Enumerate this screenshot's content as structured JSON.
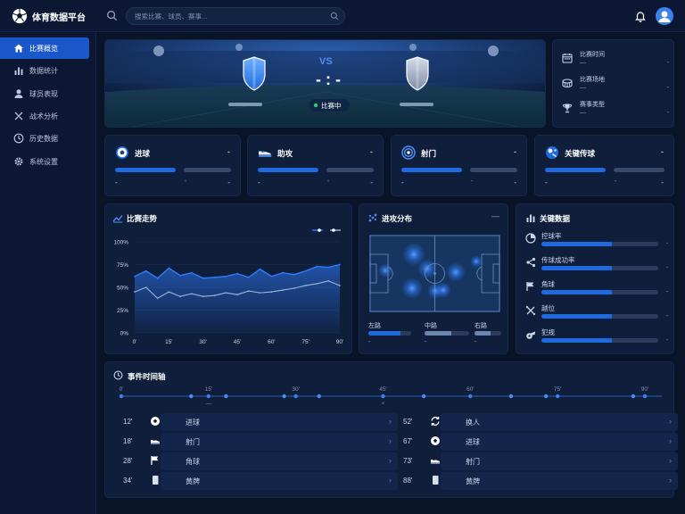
{
  "app": {
    "title": "体育数据平台"
  },
  "search": {
    "placeholder": "搜索比赛、球员、赛事..."
  },
  "sidebar": {
    "items": [
      {
        "label": "比赛概览",
        "icon": "home-icon"
      },
      {
        "label": "数据统计",
        "icon": "bar-chart-icon"
      },
      {
        "label": "球员表现",
        "icon": "user-icon"
      },
      {
        "label": "战术分析",
        "icon": "tactics-icon"
      },
      {
        "label": "历史数据",
        "icon": "clock-icon"
      },
      {
        "label": "系统设置",
        "icon": "gear-icon"
      }
    ]
  },
  "match": {
    "vs": "VS",
    "score": "- : -",
    "status": "比赛中"
  },
  "match_info": [
    {
      "label": "比赛时间",
      "value": "—",
      "value2": "-",
      "icon": "calendar-icon"
    },
    {
      "label": "比赛场地",
      "value": "—",
      "value2": "-",
      "icon": "stadium-icon"
    },
    {
      "label": "赛事类型",
      "value": "—",
      "value2": "-",
      "icon": "trophy-icon"
    }
  ],
  "stats": [
    {
      "label": "进球",
      "top": "-",
      "left": "-",
      "mid": "-",
      "right": "-",
      "icon": "soccer-ball-icon"
    },
    {
      "label": "助攻",
      "top": "-",
      "left": "-",
      "mid": "-",
      "right": "-",
      "icon": "shoe-icon"
    },
    {
      "label": "射门",
      "top": "-",
      "left": "-",
      "mid": "-",
      "right": "-",
      "icon": "target-icon"
    },
    {
      "label": "关键传球",
      "top": "-",
      "left": "-",
      "mid": "-",
      "right": "-",
      "icon": "pass-icon"
    }
  ],
  "trend": {
    "title": "比赛走势"
  },
  "attack": {
    "title": "进攻分布",
    "menu": "—",
    "zones": [
      {
        "label": "左路",
        "value": "-",
        "fill": 0.75
      },
      {
        "label": "中路",
        "value": "-",
        "fill": 0.6
      },
      {
        "label": "右路",
        "value": "-",
        "fill": 0.6
      }
    ]
  },
  "key": {
    "title": "关键数据",
    "rows": [
      {
        "label": "控球率",
        "value": "-",
        "icon": "pie-icon",
        "fill": 0.6
      },
      {
        "label": "传球成功率",
        "value": "-",
        "icon": "share-icon",
        "fill": 0.6
      },
      {
        "label": "角球",
        "value": "-",
        "icon": "flag-icon",
        "fill": 0.6
      },
      {
        "label": "越位",
        "value": "-",
        "icon": "offside-icon",
        "fill": 0.6
      },
      {
        "label": "犯规",
        "value": "-",
        "icon": "whistle-icon",
        "fill": 0.6
      }
    ]
  },
  "events": {
    "title": "事件时间轴",
    "ticks": [
      "0'",
      "15'",
      "30'",
      "45'",
      "60'",
      "75'",
      "90'"
    ],
    "marker_labels": [
      "—",
      "×"
    ],
    "markers": [
      0,
      15,
      30,
      45,
      60,
      75,
      90
    ],
    "left": [
      {
        "time": "12'",
        "label": "进球",
        "icon": "soccer-ball-icon"
      },
      {
        "time": "18'",
        "label": "射门",
        "icon": "shoe-icon"
      },
      {
        "time": "28'",
        "label": "角球",
        "icon": "flag-icon"
      },
      {
        "time": "34'",
        "label": "黄牌",
        "icon": "card-icon"
      }
    ],
    "right": [
      {
        "time": "52'",
        "label": "换人",
        "icon": "substitution-icon"
      },
      {
        "time": "67'",
        "label": "进球",
        "icon": "soccer-ball-icon"
      },
      {
        "time": "73'",
        "label": "射门",
        "icon": "shoe-icon"
      },
      {
        "time": "88'",
        "label": "黄牌",
        "icon": "card-icon"
      }
    ]
  },
  "chart_data": {
    "type": "area",
    "title": "",
    "xlabel": "",
    "ylabel": "",
    "x": [
      0,
      5,
      10,
      15,
      20,
      25,
      30,
      35,
      40,
      45,
      50,
      55,
      60,
      65,
      70,
      75,
      80,
      85,
      90
    ],
    "x_ticks": [
      "0'",
      "15'",
      "30'",
      "45'",
      "60'",
      "75'",
      "90'"
    ],
    "y_ticks": [
      "0%",
      "25%",
      "50%",
      "75%",
      "100%"
    ],
    "xlim": [
      0,
      90
    ],
    "ylim": [
      0,
      100
    ],
    "grid": true,
    "legend": "top-right",
    "series": [
      {
        "values": [
          62,
          68,
          60,
          71,
          63,
          66,
          60,
          61,
          62,
          65,
          61,
          70,
          62,
          66,
          64,
          68,
          73,
          72,
          75
        ],
        "color": "#2f7dff"
      },
      {
        "values": [
          45,
          50,
          38,
          45,
          40,
          43,
          40,
          41,
          44,
          42,
          46,
          44,
          45,
          47,
          49,
          52,
          54,
          57,
          52
        ],
        "color": "#9fb6d8"
      }
    ]
  },
  "colors": {
    "accent": "#1f6ae0",
    "bg": "#0a1428",
    "panel": "#0f1e3b",
    "live": "#2ecc71"
  }
}
